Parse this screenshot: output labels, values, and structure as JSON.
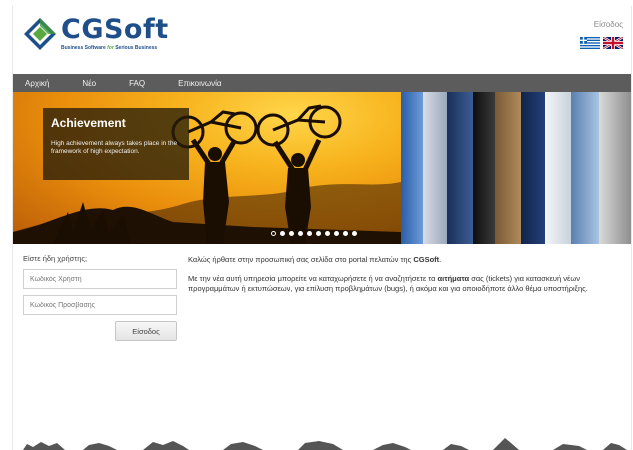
{
  "header": {
    "logo": {
      "name": "CGSoft",
      "tagline_a": "Business Software ",
      "tagline_for": "for",
      "tagline_b": " Serious Business"
    },
    "login_link": "Είσοδος",
    "flags": [
      "flag-greece-icon",
      "flag-uk-icon"
    ]
  },
  "nav": {
    "items": [
      "Αρχική",
      "Νέο",
      "FAQ",
      "Επικοινωνία"
    ]
  },
  "banner": {
    "caption_title": "Achievement",
    "caption_text": "High achievement always takes place in the framework of high expectation.",
    "dot_count": 10,
    "active_dot": 0
  },
  "login": {
    "title": "Είστε ήδη χρήστης;",
    "username_placeholder": "Κωδικός Χρήστη",
    "password_placeholder": "Κωδικός Πρόσβασης",
    "button": "Είσοδος"
  },
  "main": {
    "intro_a": "Καλώς ήρθατε στην προσωπική σας σελίδα στο portal πελατών της ",
    "intro_brand": "CGSoft",
    "intro_b": ".",
    "body_a": "Με την νέα αυτή υπηρεσία μπορείτε να καταχωρήσετε ή να αναζητήσετε τα ",
    "body_bold": "αιτήματα",
    "body_b": " σας (tickets) για κατασκευή νέων προγραμμάτων ή εκτυπώσεων, για επίλυση προβλημάτων (bugs), ή ακόμα και για οποιοδήποτε άλλο θέμα υποστήριξης."
  },
  "colors": {
    "brand_blue": "#1f4f8a",
    "brand_green": "#5aa840",
    "nav_bg": "#5c5c5c"
  }
}
